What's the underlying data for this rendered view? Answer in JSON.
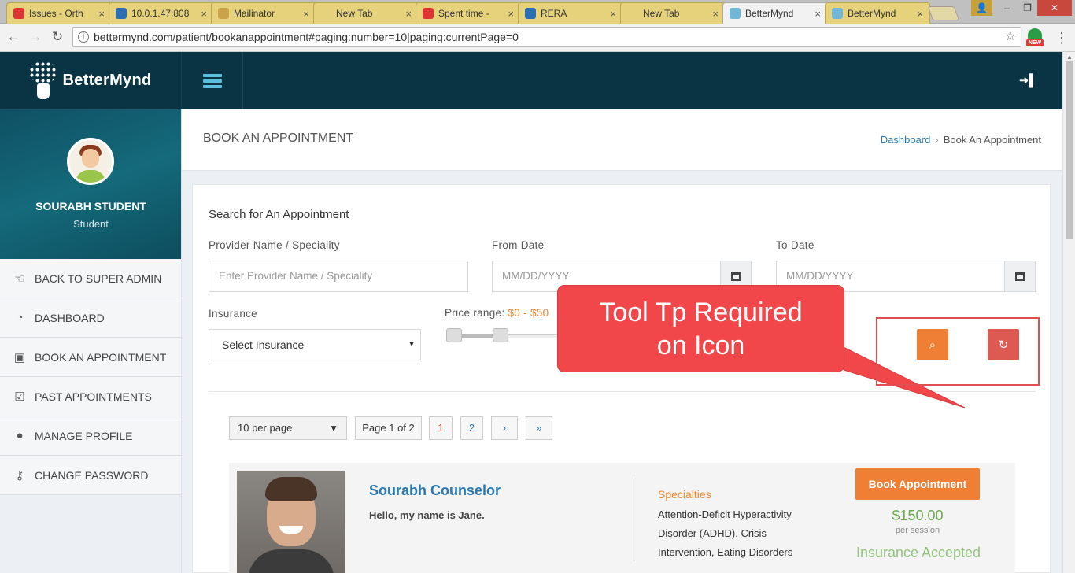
{
  "browser": {
    "tabs": [
      {
        "title": "Issues - Orth",
        "color": "#d33",
        "active": false
      },
      {
        "title": "10.0.1.47:808",
        "color": "#2a6fb5",
        "active": false
      },
      {
        "title": "Mailinator",
        "color": "#c9a24a",
        "active": false
      },
      {
        "title": "New Tab",
        "color": "",
        "active": false
      },
      {
        "title": "Spent time -",
        "color": "#d33",
        "active": false
      },
      {
        "title": "RERA",
        "color": "#2a6fb5",
        "active": false
      },
      {
        "title": "New Tab",
        "color": "",
        "active": false
      },
      {
        "title": "BetterMynd",
        "color": "#6fb7d6",
        "active": true
      },
      {
        "title": "BetterMynd",
        "color": "#6fb7d6",
        "active": false
      }
    ],
    "url": "bettermynd.com/patient/bookanappointment#paging:number=10|paging:currentPage=0",
    "ext_badge": "NEW"
  },
  "brand": {
    "name": "BetterMynd"
  },
  "user": {
    "name": "SOURABH STUDENT",
    "role": "Student"
  },
  "menu": [
    {
      "label": "BACK TO SUPER ADMIN",
      "icon": "hand-point-left-icon",
      "glyph": "☜"
    },
    {
      "label": "DASHBOARD",
      "icon": "dashboard-icon",
      "glyph": "◔"
    },
    {
      "label": "BOOK AN APPOINTMENT",
      "icon": "calendar-plus-icon",
      "glyph": "▣"
    },
    {
      "label": "PAST APPOINTMENTS",
      "icon": "calendar-check-icon",
      "glyph": "☑"
    },
    {
      "label": "MANAGE PROFILE",
      "icon": "user-icon",
      "glyph": "●"
    },
    {
      "label": "CHANGE PASSWORD",
      "icon": "key-icon",
      "glyph": "⚷"
    }
  ],
  "page": {
    "title": "BOOK AN APPOINTMENT",
    "breadcrumb": {
      "home": "Dashboard",
      "current": "Book An Appointment"
    }
  },
  "search": {
    "heading": "Search for An Appointment",
    "provider_label": "Provider Name / Speciality",
    "provider_placeholder": "Enter Provider Name / Speciality",
    "from_label": "From Date",
    "from_placeholder": "MM/DD/YYYY",
    "to_label": "To Date",
    "to_placeholder": "MM/DD/YYYY",
    "insurance_label": "Insurance",
    "insurance_value": "Select Insurance",
    "price_label": "Price range:",
    "price_value": "$0 - $50",
    "price_range": {
      "min": 0,
      "max": 50,
      "low_fraction": 0.0,
      "high_fraction": 0.45
    },
    "search_color": "#ef7f34",
    "reset_color": "#dd5a52"
  },
  "pagination": {
    "per_page": "10 per page",
    "page_info": "Page 1 of 2",
    "pages": [
      "1",
      "2"
    ],
    "next": "›",
    "last": "»"
  },
  "counselor": {
    "name": "Sourabh Counselor",
    "intro": "Hello, my name is Jane.",
    "specialties_heading": "Specialties",
    "specialties": "Attention-Deficit Hyperactivity Disorder (ADHD), Crisis Intervention, Eating Disorders",
    "book_label": "Book Appointment",
    "price": "$150.00",
    "per_session": "per session",
    "insurance": "Insurance Accepted"
  },
  "annotation": {
    "line1": "Tool Tp Required",
    "line2": "on Icon",
    "color": "#f2474a"
  }
}
